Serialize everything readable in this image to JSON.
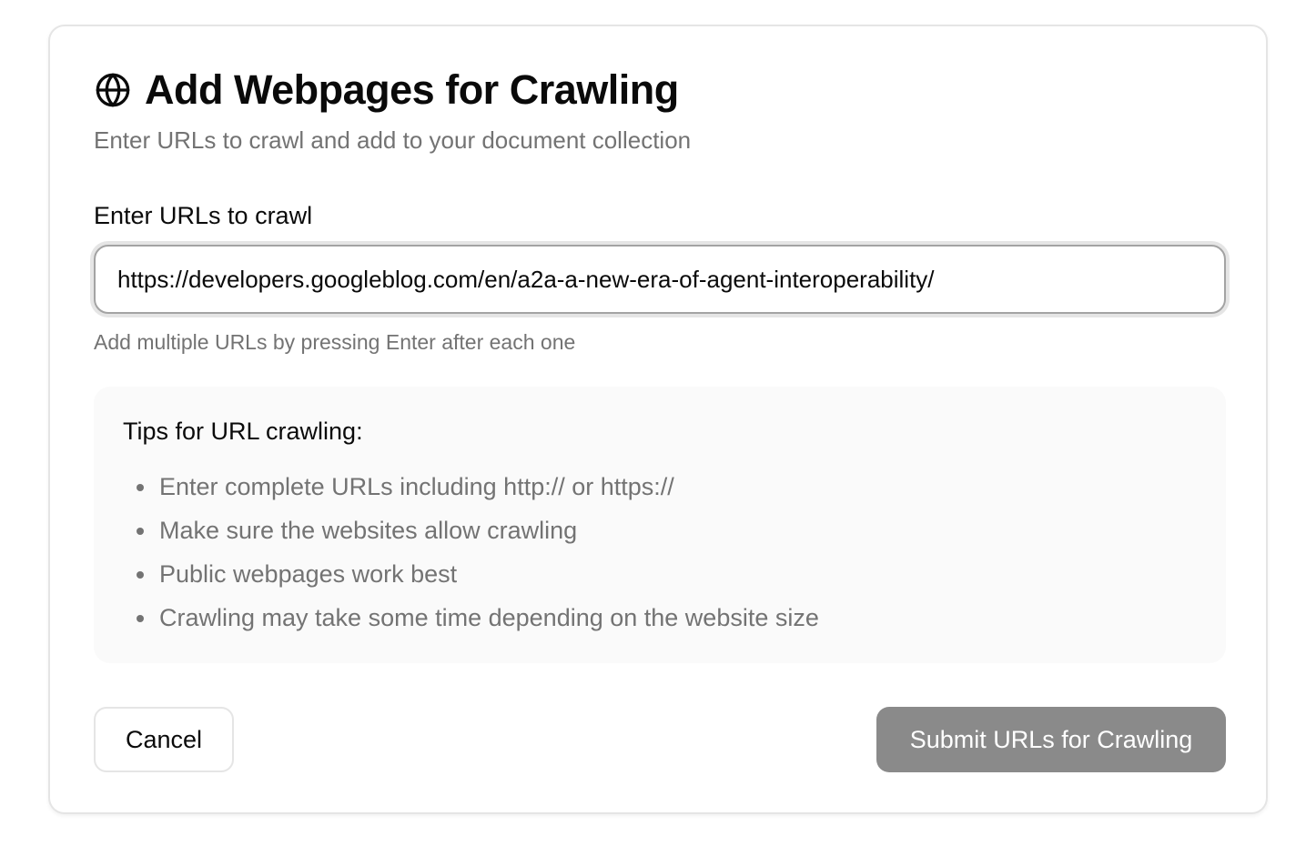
{
  "dialog": {
    "icon": "globe-icon",
    "title": "Add Webpages for Crawling",
    "subtitle": "Enter URLs to crawl and add to your document collection"
  },
  "url_field": {
    "label": "Enter URLs to crawl",
    "value": "https://developers.googleblog.com/en/a2a-a-new-era-of-agent-interoperability/",
    "hint": "Add multiple URLs by pressing Enter after each one"
  },
  "tips": {
    "title": "Tips for URL crawling:",
    "items": [
      "Enter complete URLs including http:// or https://",
      "Make sure the websites allow crawling",
      "Public webpages work best",
      "Crawling may take some time depending on the website size"
    ]
  },
  "actions": {
    "cancel_label": "Cancel",
    "submit_label": "Submit URLs for Crawling"
  },
  "colors": {
    "submit_disabled_bg": "#8a8a8a",
    "muted_text": "#737373",
    "tips_bg": "#fafafa"
  }
}
